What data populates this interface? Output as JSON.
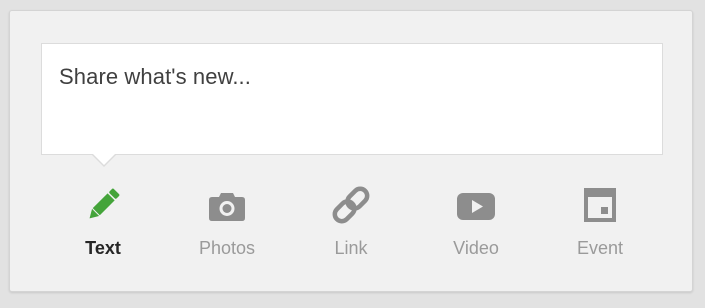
{
  "composer": {
    "placeholder": "Share what's new..."
  },
  "post_types": [
    {
      "label": "Text",
      "icon": "pencil-icon",
      "active": true
    },
    {
      "label": "Photos",
      "icon": "camera-icon",
      "active": false
    },
    {
      "label": "Link",
      "icon": "link-icon",
      "active": false
    },
    {
      "label": "Video",
      "icon": "video-icon",
      "active": false
    },
    {
      "label": "Event",
      "icon": "calendar-icon",
      "active": false
    }
  ],
  "colors": {
    "active_icon": "#44a43a",
    "inactive_icon": "#8d8d8d",
    "active_label": "#262626",
    "inactive_label": "#9a9a9a"
  }
}
